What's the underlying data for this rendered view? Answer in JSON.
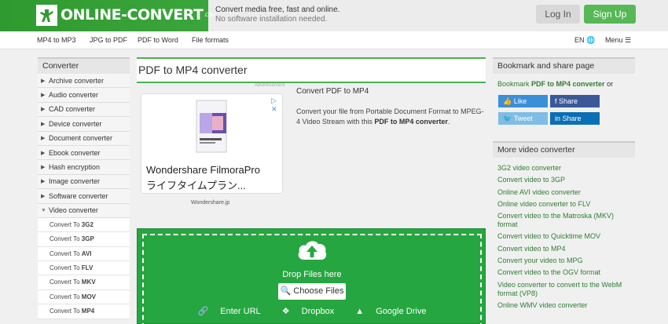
{
  "header": {
    "logo_text": "ONLINE-CONVERT",
    "logo_suffix": ".COM",
    "tagline1": "Convert media free, fast and online.",
    "tagline2": "No software installation needed.",
    "login": "Log In",
    "signup": "Sign Up"
  },
  "nav": {
    "items": [
      "MP4 to MP3",
      "JPG to PDF",
      "PDF to Word",
      "File formats"
    ],
    "lang": "EN",
    "menu": "Menu"
  },
  "sidebar": {
    "title": "Converter",
    "items": [
      "Archive converter",
      "Audio converter",
      "CAD converter",
      "Device converter",
      "Document converter",
      "Ebook converter",
      "Hash encryption",
      "Image converter",
      "Software converter",
      "Video converter"
    ],
    "sub_prefix": "Convert To",
    "sub_items": [
      "3G2",
      "3GP",
      "AVI",
      "FLV",
      "MKV",
      "MOV",
      "MP4"
    ]
  },
  "main": {
    "title": "PDF to MP4 converter",
    "ad_label": "Advertisement",
    "ad_name": "Wondershare FilmoraPro",
    "ad_jp": "ライフタイムプラン...",
    "ad_src": "Wondershare.jp",
    "conv_head": "Convert PDF to MP4",
    "conv_desc": "Convert your file from Portable Document Format to MPEG-4 Video Stream with this",
    "conv_desc_bold": "PDF to MP4 converter",
    "drop_text": "Drop Files here",
    "choose": "Choose Files",
    "enter_url": "Enter URL",
    "dropbox": "Dropbox",
    "gdrive": "Google Drive"
  },
  "right": {
    "bm_title": "Bookmark and share page",
    "bm_prefix": "Bookmark",
    "bm_bold": "PDF to MP4 converter",
    "bm_or": "or",
    "like": "Like",
    "share1": "Share",
    "tweet": "Tweet",
    "share2": "Share",
    "more_title": "More video converter",
    "links": [
      "3G2 video converter",
      "Convert video to 3GP",
      "Online AVI video converter",
      "Online video converter to FLV",
      "Convert video to the Matroska (MKV) format",
      "Convert video to Quicktime MOV",
      "Convert video to MP4",
      "Convert your video to MPG",
      "Convert video to the OGV format",
      "Video converter to convert to the WebM format (VP8)",
      "Online WMV video converter"
    ]
  },
  "colors": {
    "brand_green": "#26a640",
    "link_green": "#2e7d32"
  }
}
